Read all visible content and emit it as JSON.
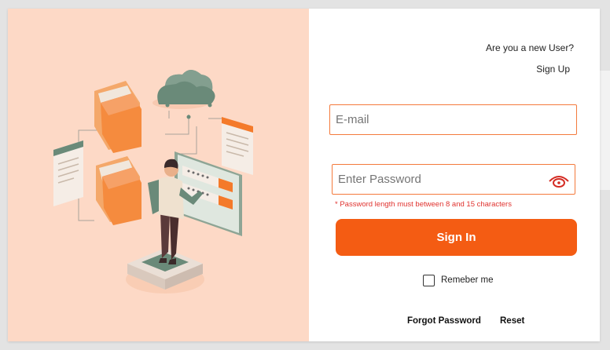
{
  "colors": {
    "accent": "#f45c13",
    "field_border": "#f47a3c",
    "hint_text": "#e0332f",
    "illustration_bg": "#fdd9c6"
  },
  "illustration": {
    "icon": "cloud-storage-illustration"
  },
  "signup": {
    "prompt": "Are you a new User?",
    "link": "Sign Up"
  },
  "form": {
    "email_placeholder": "E-mail",
    "password_placeholder": "Enter Password",
    "password_hint": "* Password length must between 8 and 15 characters",
    "show_password_icon": "eye-icon",
    "submit_label": "Sign In",
    "remember_label": "Remeber me",
    "forgot_label": "Forgot Password",
    "reset_label": "Reset"
  }
}
